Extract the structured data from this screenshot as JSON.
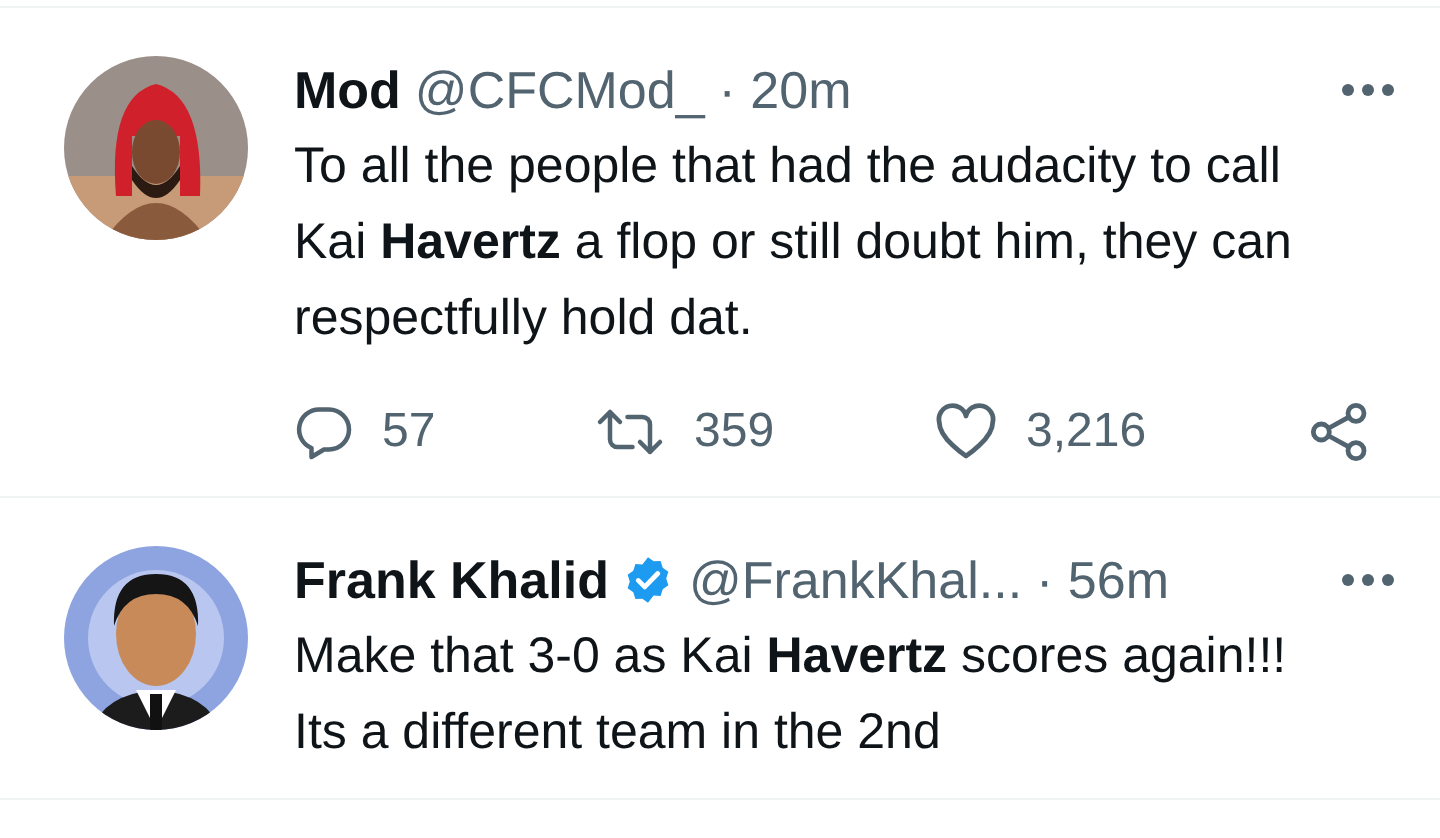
{
  "tweets": [
    {
      "name": "Mod",
      "verified": false,
      "handle": "@CFCMod_",
      "time": "· 20m",
      "text": "To all the people that had the audacity to call Kai **Havertz** a flop or still doubt him, they can respectfully hold dat.",
      "actions": {
        "replies": "57",
        "retweets": "359",
        "likes": "3,216"
      }
    },
    {
      "name": "Frank Khalid",
      "verified": true,
      "handle": "@FrankKhal...",
      "time": "· 56m",
      "text": "Make that 3-0 as Kai **Havertz** scores again!!! Its a different team in the 2nd"
    }
  ]
}
